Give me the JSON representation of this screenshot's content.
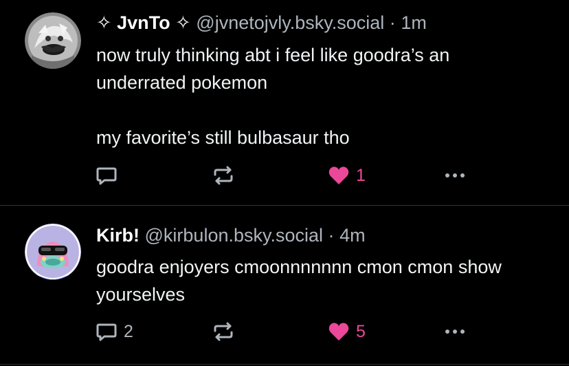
{
  "colors": {
    "background": "#000000",
    "text": "#f1f3f5",
    "muted": "#aeb5bc",
    "like": "#ec4899",
    "divider": "#2e3338"
  },
  "posts": [
    {
      "display_name": "✧ JvnTo ✧",
      "handle": "@jvnetojvly.bsky.social",
      "separator": "·",
      "time": "1m",
      "text_lines": [
        "now truly thinking abt i feel like goodra’s an underrated pokemon",
        "my favorite’s still bulbasaur tho"
      ],
      "reply_count": "",
      "like_count": "1",
      "liked": true,
      "icons": [
        "reply-icon",
        "repost-icon",
        "heart-icon",
        "more-icon"
      ]
    },
    {
      "display_name": "Kirb!",
      "handle": "@kirbulon.bsky.social",
      "separator": "·",
      "time": "4m",
      "text_lines": [
        "goodra enjoyers cmoonnnnnnn cmon cmon show yourselves"
      ],
      "reply_count": "2",
      "like_count": "5",
      "liked": true,
      "icons": [
        "reply-icon",
        "repost-icon",
        "heart-icon",
        "more-icon"
      ]
    }
  ]
}
